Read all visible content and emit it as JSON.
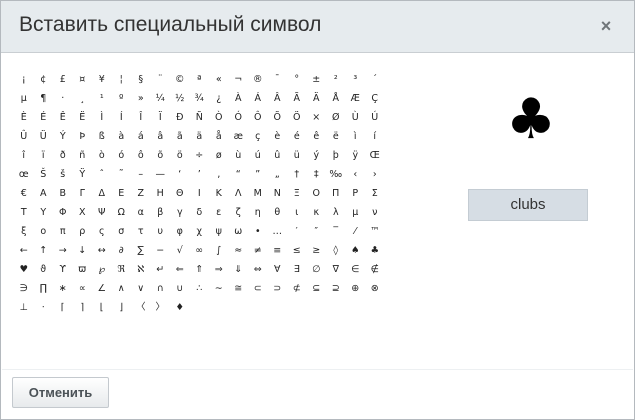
{
  "dialog": {
    "title": "Вставить специальный символ",
    "close_label": "×"
  },
  "symbols": [
    "¡",
    "¢",
    "£",
    "¤",
    "¥",
    "¦",
    "§",
    "¨",
    "©",
    "ª",
    "«",
    "¬",
    "®",
    "¯",
    "°",
    "±",
    "²",
    "³",
    "´",
    "µ",
    "¶",
    "·",
    "¸",
    "¹",
    "º",
    "»",
    "¼",
    "½",
    "¾",
    "¿",
    "À",
    "Á",
    "Â",
    "Ã",
    "Ä",
    "Å",
    "Æ",
    "Ç",
    "È",
    "É",
    "Ê",
    "Ë",
    "Ì",
    "Í",
    "Î",
    "Ï",
    "Ð",
    "Ñ",
    "Ò",
    "Ó",
    "Ô",
    "Õ",
    "Ö",
    "×",
    "Ø",
    "Ù",
    "Ú",
    "Û",
    "Ü",
    "Ý",
    "Þ",
    "ß",
    "à",
    "á",
    "â",
    "ã",
    "ä",
    "å",
    "æ",
    "ç",
    "è",
    "é",
    "ê",
    "ë",
    "ì",
    "í",
    "î",
    "ï",
    "ð",
    "ñ",
    "ò",
    "ó",
    "ô",
    "õ",
    "ö",
    "÷",
    "ø",
    "ù",
    "ú",
    "û",
    "ü",
    "ý",
    "þ",
    "ÿ",
    "Œ",
    "œ",
    "Š",
    "š",
    "Ÿ",
    "ˆ",
    "˜",
    "–",
    "—",
    "‘",
    "’",
    "‚",
    "“",
    "”",
    "„",
    "†",
    "‡",
    "‰",
    "‹",
    "›",
    "€",
    "Α",
    "Β",
    "Γ",
    "Δ",
    "Ε",
    "Ζ",
    "Η",
    "Θ",
    "Ι",
    "Κ",
    "Λ",
    "Μ",
    "Ν",
    "Ξ",
    "Ο",
    "Π",
    "Ρ",
    "Σ",
    "Τ",
    "Υ",
    "Φ",
    "Χ",
    "Ψ",
    "Ω",
    "α",
    "β",
    "γ",
    "δ",
    "ε",
    "ζ",
    "η",
    "θ",
    "ι",
    "κ",
    "λ",
    "μ",
    "ν",
    "ξ",
    "ο",
    "π",
    "ρ",
    "ς",
    "σ",
    "τ",
    "υ",
    "φ",
    "χ",
    "ψ",
    "ω",
    "•",
    "…",
    "′",
    "″",
    "‾",
    "⁄",
    "™",
    "←",
    "↑",
    "→",
    "↓",
    "↔",
    "∂",
    "∑",
    "−",
    "√",
    "∞",
    "∫",
    "≈",
    "≠",
    "≡",
    "≤",
    "≥",
    "◊",
    "♠",
    "♣",
    "♥",
    "ϑ",
    "ϒ",
    "ϖ",
    "℘",
    "ℜ",
    "ℵ",
    "↵",
    "⇐",
    "⇑",
    "⇒",
    "⇓",
    "⇔",
    "∀",
    "∃",
    "∅",
    "∇",
    "∈",
    "∉",
    "∋",
    "∏",
    "∗",
    "∝",
    "∠",
    "∧",
    "∨",
    "∩",
    "∪",
    "∴",
    "∼",
    "≅",
    "⊂",
    "⊃",
    "⊄",
    "⊆",
    "⊇",
    "⊕",
    "⊗",
    "⊥",
    "⋅",
    "⌈",
    "⌉",
    "⌊",
    "⌋",
    "〈",
    "〉",
    "♦"
  ],
  "preview": {
    "symbol": "♣",
    "name": "clubs"
  },
  "footer": {
    "cancel_label": "Отменить"
  }
}
